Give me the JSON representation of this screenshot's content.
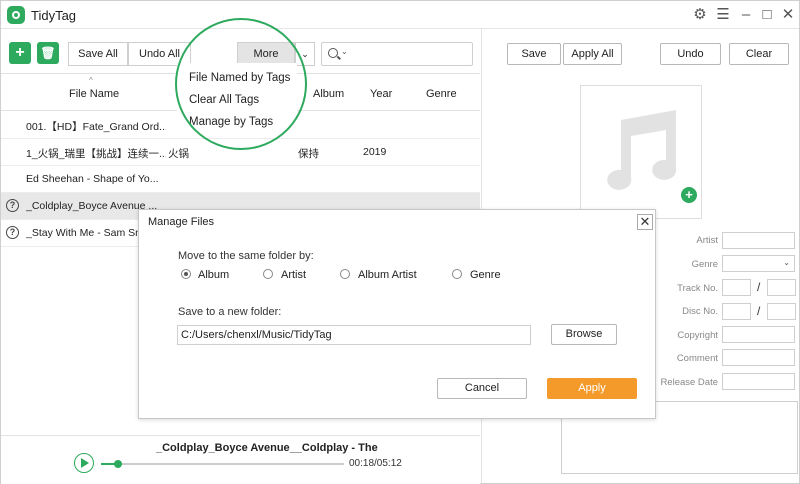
{
  "app": {
    "title": "TidyTag"
  },
  "toolbar": {
    "save_all": "Save All",
    "undo_all": "Undo All",
    "more": "More"
  },
  "more_menu": {
    "items": [
      "File Named by Tags",
      "Clear All Tags",
      "Manage by Tags"
    ]
  },
  "table": {
    "headers": [
      "File Name",
      "Album",
      "Year",
      "Genre"
    ],
    "rows": [
      {
        "name": "001.【HD】Fate_Grand Ord...",
        "artist": "",
        "album": "",
        "year": ""
      },
      {
        "name": "1_火锅_瑞里【挑战】连续一...",
        "artist": "火锅",
        "album": "保持",
        "year": "2019"
      },
      {
        "name": "Ed Sheehan - Shape of Yo...",
        "artist": "",
        "album": "",
        "year": ""
      },
      {
        "name": "_Coldplay_Boyce Avenue ...",
        "artist": "",
        "album": "",
        "year": ""
      },
      {
        "name": "_Stay With Me - Sam Sn",
        "artist": "",
        "album": "",
        "year": ""
      }
    ]
  },
  "right": {
    "save": "Save",
    "apply_all": "Apply All",
    "undo": "Undo",
    "clear": "Clear",
    "fields": [
      "Artist",
      "Genre",
      "Track No.",
      "Disc No.",
      "Copyright",
      "Comment",
      "Release Date"
    ],
    "slash": "/"
  },
  "player": {
    "title": "_Coldplay_Boyce Avenue__Coldplay - The",
    "time": "00:18/05:12",
    "progress": 0.07
  },
  "dialog": {
    "title": "Manage Files",
    "close": "✕",
    "move_label": "Move to the same folder by:",
    "options": [
      "Album",
      "Artist",
      "Album Artist",
      "Genre"
    ],
    "selected": "Album",
    "save_label": "Save to a new folder:",
    "path": "C:/Users/chenxl/Music/TidyTag",
    "browse": "Browse",
    "cancel": "Cancel",
    "apply": "Apply"
  },
  "colors": {
    "accent": "#2eaa5f",
    "apply": "#f39a2b"
  }
}
